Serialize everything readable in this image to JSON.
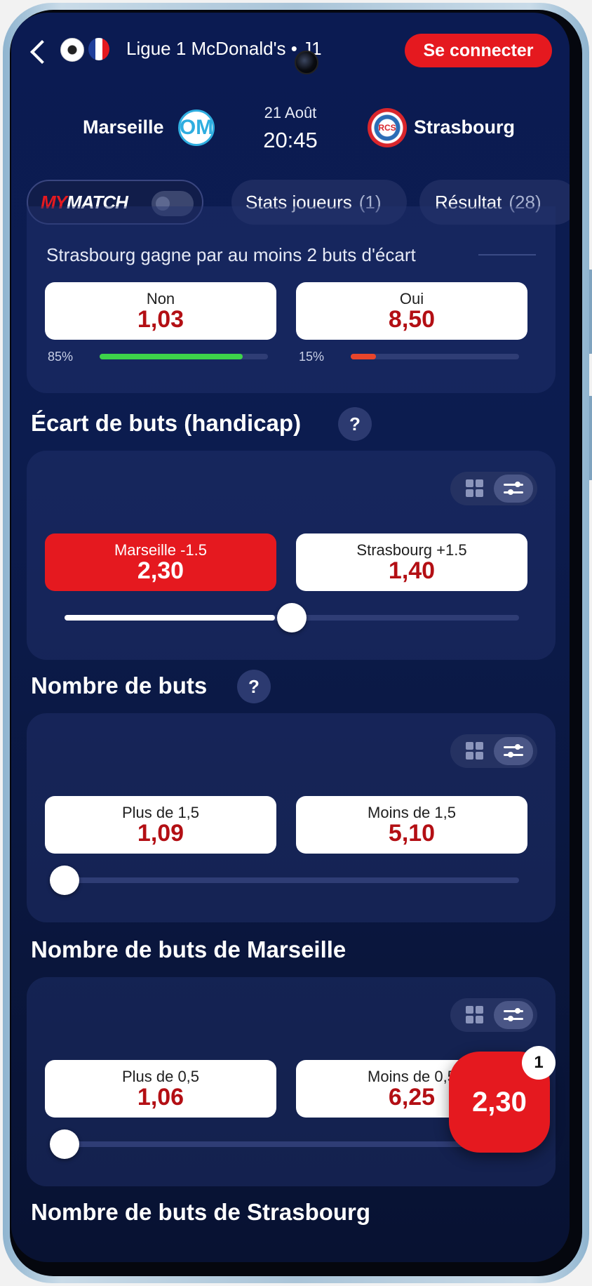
{
  "header": {
    "league": "Ligue 1 McDonald's • J1",
    "connect_label": "Se connecter",
    "flag_colors": [
      "#1f3f9a",
      "#ffffff",
      "#e5191f"
    ]
  },
  "match": {
    "home": "Marseille",
    "away": "Strasbourg",
    "date": "21 Août",
    "time": "20:45",
    "home_crest": "OM",
    "away_crest": "RCS"
  },
  "tabs": {
    "mymatch_left": "MY",
    "mymatch_right": "MATCH",
    "stats_label": "Stats joueurs",
    "stats_count": "(1)",
    "result_label": "Résultat",
    "result_count": "(28)"
  },
  "margin_market": {
    "subtitle": "Strasbourg gagne par au moins 2 buts d'écart",
    "options": [
      {
        "label": "Non",
        "odds": "1,03",
        "pct_label": "85%",
        "pct": 0.85,
        "bar_color": "#3dd34a"
      },
      {
        "label": "Oui",
        "odds": "8,50",
        "pct_label": "15%",
        "pct": 0.15,
        "bar_color": "#e8452b"
      }
    ]
  },
  "handicap": {
    "title": "Écart de buts (handicap)",
    "help": "?",
    "options": [
      {
        "label": "Marseille -1.5",
        "odds": "2,30",
        "selected": true
      },
      {
        "label": "Strasbourg +1.5",
        "odds": "1,40",
        "selected": false
      }
    ],
    "slider_level": 0.5
  },
  "total_goals": {
    "title": "Nombre de buts",
    "help": "?",
    "options": [
      {
        "label": "Plus de 1,5",
        "odds": "1,09"
      },
      {
        "label": "Moins de 1,5",
        "odds": "5,10"
      }
    ],
    "slider_level": 0
  },
  "marseille_goals": {
    "title": "Nombre de buts de Marseille",
    "options": [
      {
        "label": "Plus de 0,5",
        "odds": "1,06"
      },
      {
        "label": "Moins de 0,5",
        "odds": "6,25"
      }
    ],
    "slider_level": 0
  },
  "strasbourg_goals": {
    "title": "Nombre de buts de Strasbourg"
  },
  "betslip": {
    "total": "2,30",
    "count": "1"
  }
}
